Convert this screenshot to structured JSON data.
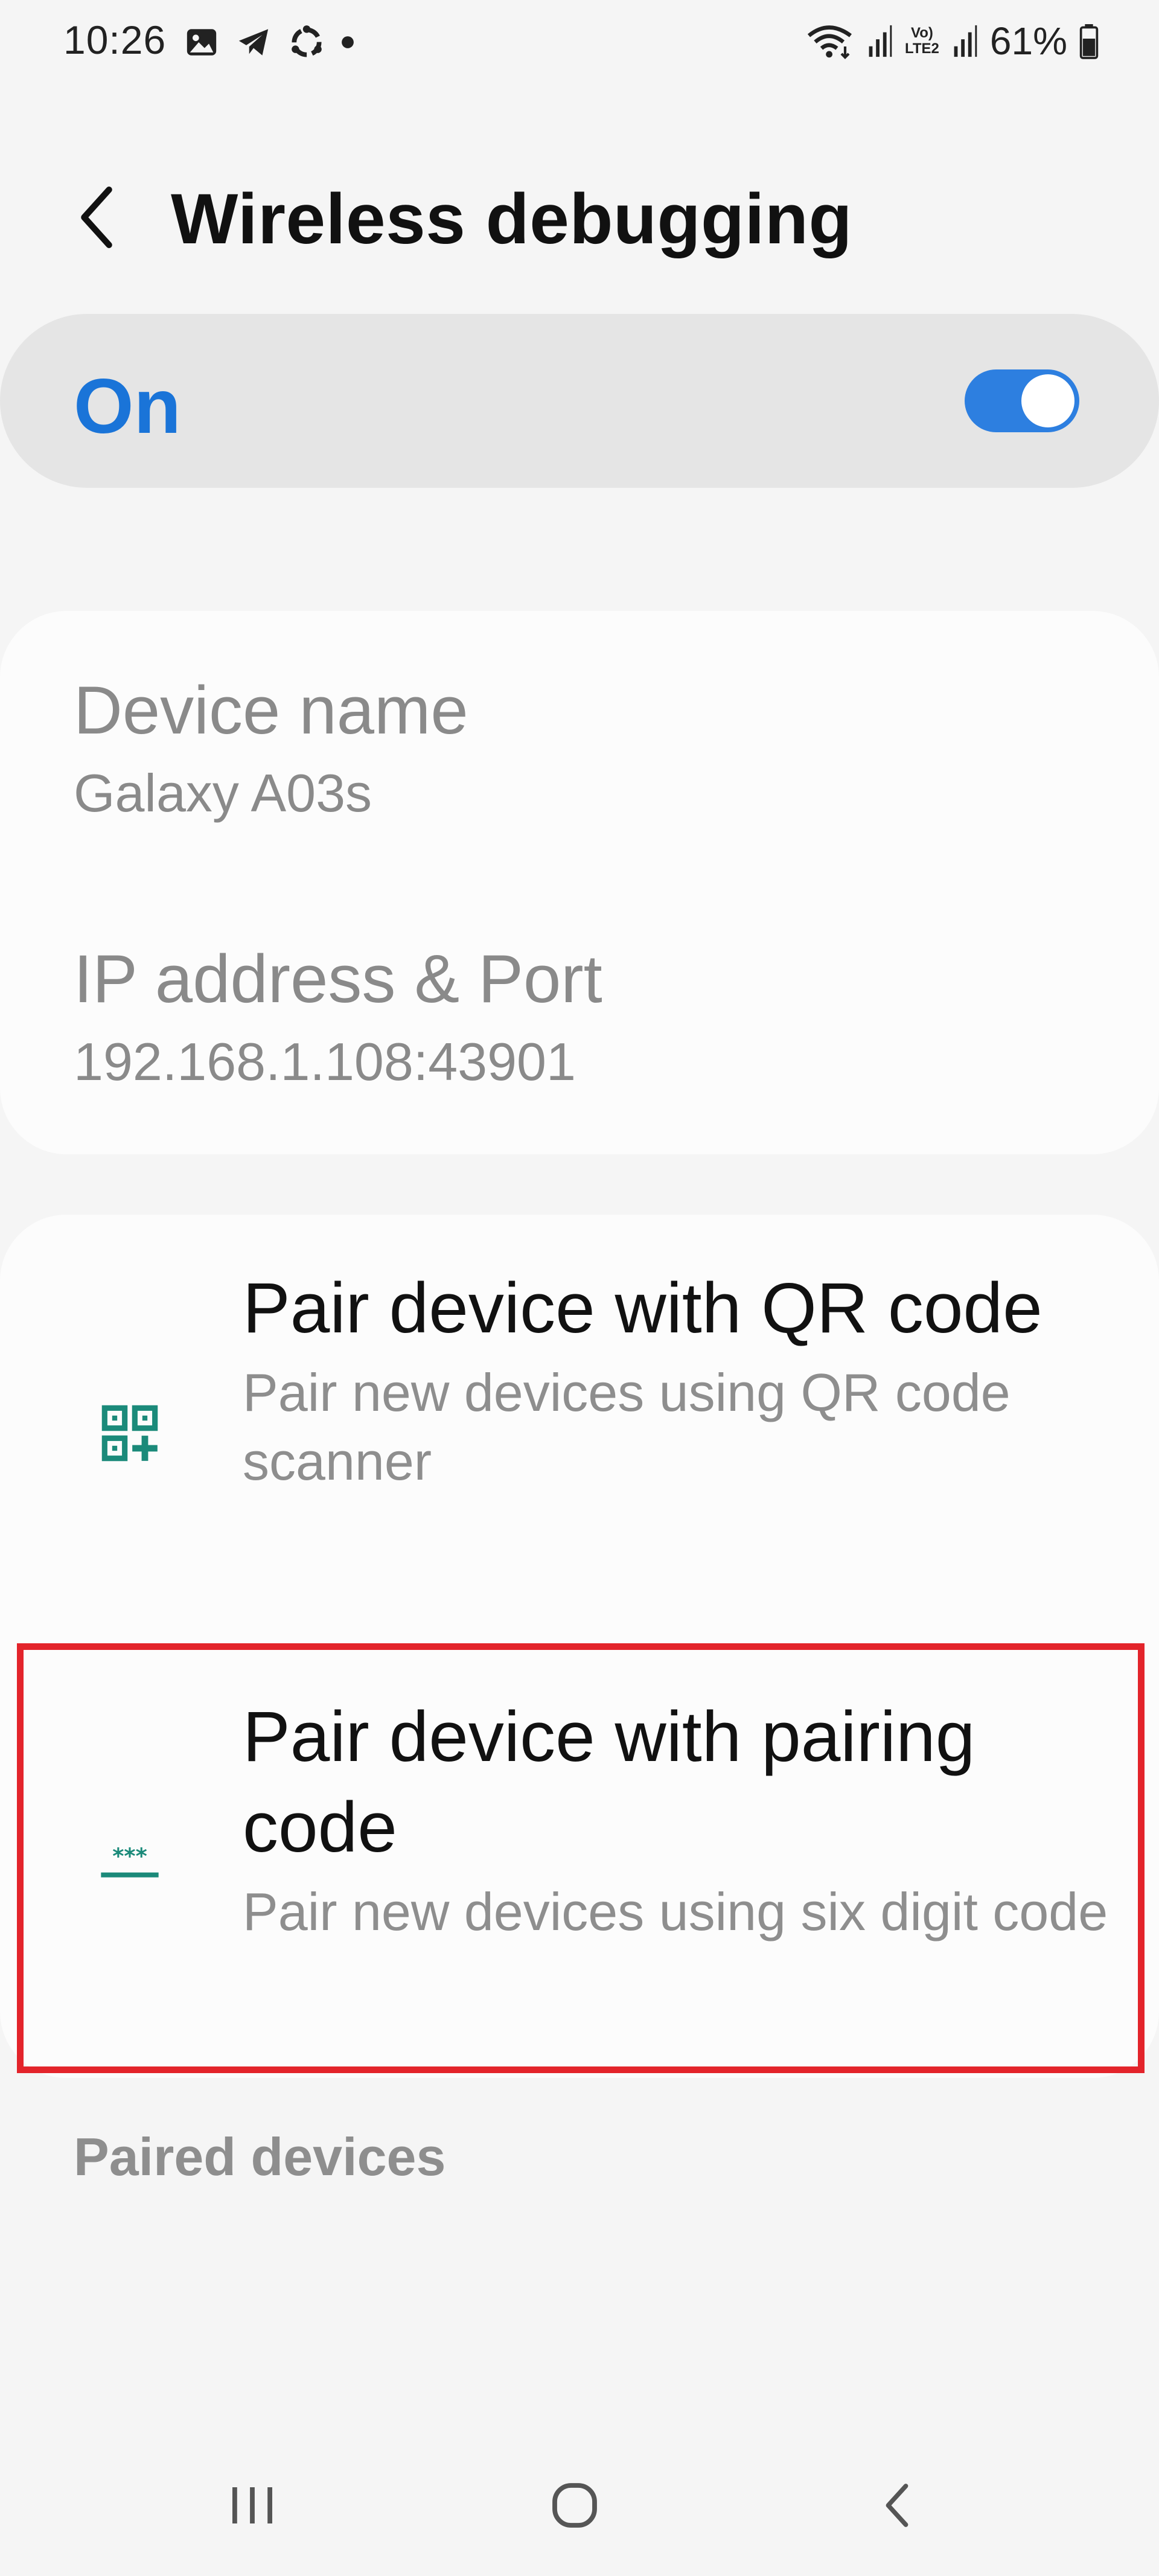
{
  "status_bar": {
    "time": "10:26",
    "battery_percent": "61%",
    "network_label_top": "Vo)",
    "network_label_bottom": "LTE2",
    "left_icons": [
      "gallery-icon",
      "telegram-icon",
      "sync-app-icon",
      "notification-dot-icon"
    ],
    "right_icons": [
      "wifi-icon",
      "signal-icon",
      "volte-icon",
      "signal-icon",
      "battery-icon"
    ]
  },
  "header": {
    "title": "Wireless debugging"
  },
  "master_switch": {
    "label": "On",
    "checked": true
  },
  "info": {
    "device_name_title": "Device name",
    "device_name_value": "Galaxy A03s",
    "ip_title": "IP address & Port",
    "ip_value": "192.168.1.108:43901"
  },
  "pair_options": [
    {
      "title": "Pair device with QR code",
      "summary": "Pair new devices using QR code scanner",
      "icon": "qr-code-icon"
    },
    {
      "title": "Pair device with pairing code",
      "summary": "Pair new devices using six digit code",
      "icon": "pairing-code-icon"
    }
  ],
  "paired_devices_header": "Paired devices",
  "colors": {
    "accent": "#1a74d8",
    "toggle_track": "#2d7fe0",
    "icon_teal": "#1b8a7a",
    "highlight": "#e3242b",
    "background": "#f5f5f5",
    "card": "#fcfcfc"
  }
}
